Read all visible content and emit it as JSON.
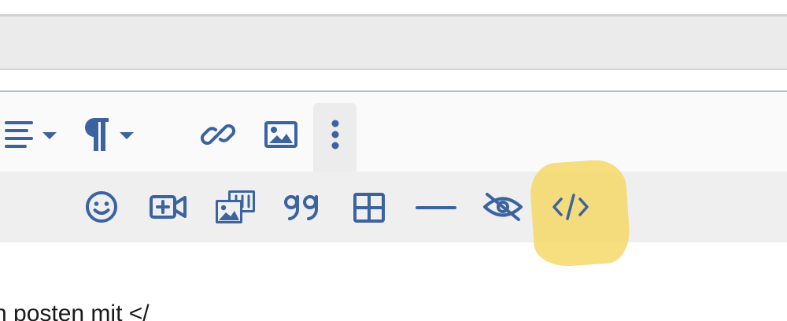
{
  "editor": {
    "body_text": "n posten mit </"
  },
  "toolbar": {
    "row1": [
      {
        "icon": "align-left-icon",
        "has_dropdown": true
      },
      {
        "icon": "paragraph-icon",
        "has_dropdown": true
      },
      {
        "icon": "link-icon"
      },
      {
        "icon": "image-icon"
      },
      {
        "icon": "more-vertical-icon",
        "active": true
      }
    ],
    "row2": [
      {
        "icon": "smiley-icon"
      },
      {
        "icon": "video-add-icon"
      },
      {
        "icon": "gallery-icon"
      },
      {
        "icon": "quote-icon"
      },
      {
        "icon": "table-icon"
      },
      {
        "icon": "horizontal-rule-icon"
      },
      {
        "icon": "spoiler-hide-icon"
      },
      {
        "icon": "code-icon",
        "highlighted": true
      }
    ]
  },
  "colors": {
    "icon": "#3b63a0",
    "highlight": "#f5d55a",
    "toolbar_row1_bg": "#fafafa",
    "toolbar_row2_bg": "#efefef",
    "input_bar_bg": "#ebebeb"
  }
}
